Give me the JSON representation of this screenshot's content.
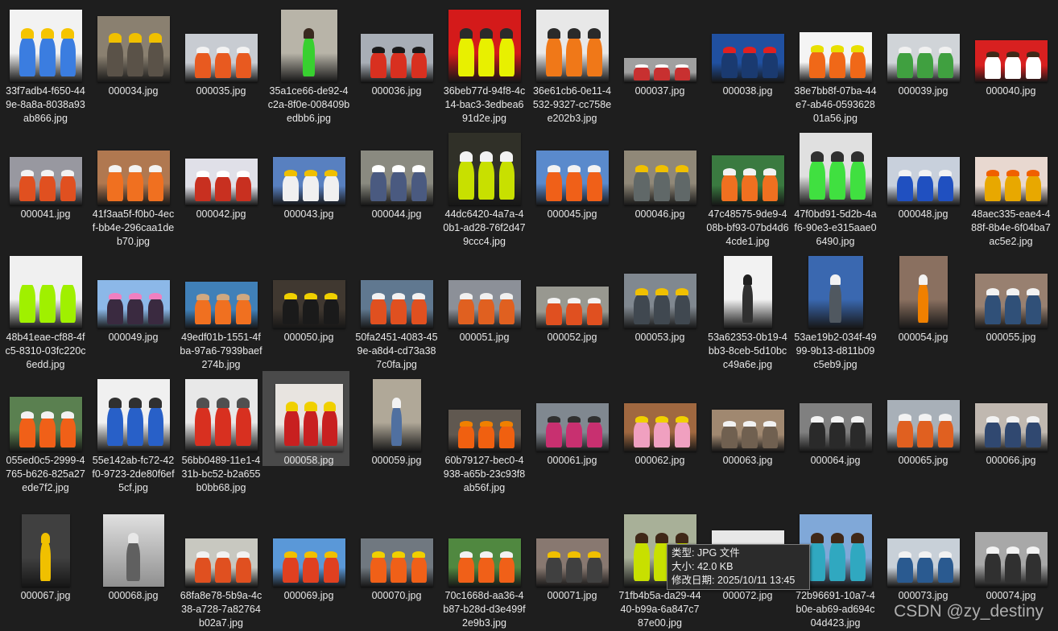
{
  "items": [
    {
      "name": "33f7adb4-f650-449e-8a8a-8038a93ab866.jpg",
      "w": 90,
      "h": 90,
      "bg": "#f2f2f2",
      "acc": "#3b7de0",
      "hat": "#f5c400"
    },
    {
      "name": "000034.jpg",
      "w": 90,
      "h": 82,
      "bg": "#8a8070",
      "acc": "#5a5248",
      "hat": "#f0c000"
    },
    {
      "name": "000035.jpg",
      "w": 90,
      "h": 60,
      "bg": "#c8ccd2",
      "acc": "#e85a20",
      "hat": "#f2f2f2"
    },
    {
      "name": "35a1ce66-de92-4c2a-8f0e-008409bedbb6.jpg",
      "w": 70,
      "h": 90,
      "bg": "#b8b4a8",
      "acc": "#38d030",
      "hat": "#3a2a20"
    },
    {
      "name": "000036.jpg",
      "w": 90,
      "h": 60,
      "bg": "#a8aeb6",
      "acc": "#d83020",
      "hat": "#1a1a1a"
    },
    {
      "name": "36beb77d-94f8-4c14-bac3-3edbea691d2e.jpg",
      "w": 90,
      "h": 90,
      "bg": "#d41a1a",
      "acc": "#e8f000",
      "hat": "#2a2a2a"
    },
    {
      "name": "36e61cb6-0e11-4532-9327-cc758ee202b3.jpg",
      "w": 90,
      "h": 90,
      "bg": "#e8e8e8",
      "acc": "#f07818",
      "hat": "#2a2a2a"
    },
    {
      "name": "000037.jpg",
      "w": 90,
      "h": 30,
      "bg": "#a0a0a0",
      "acc": "#c83030",
      "hat": "#ffffff"
    },
    {
      "name": "000038.jpg",
      "w": 90,
      "h": 60,
      "bg": "#2050a0",
      "acc": "#1a3a70",
      "hat": "#e02020"
    },
    {
      "name": "38e7bb8f-07ba-44e7-ab46-059362801a56.jpg",
      "w": 90,
      "h": 62,
      "bg": "#f4f4f4",
      "acc": "#f06818",
      "hat": "#e8e000"
    },
    {
      "name": "000039.jpg",
      "w": 90,
      "h": 60,
      "bg": "#d0d4d8",
      "acc": "#40a040",
      "hat": "#f0f0f0"
    },
    {
      "name": "000040.jpg",
      "w": 90,
      "h": 52,
      "bg": "#d82020",
      "acc": "#ffffff",
      "hat": "#402818"
    },
    {
      "name": "000041.jpg",
      "w": 90,
      "h": 60,
      "bg": "#9898a0",
      "acc": "#e05020",
      "hat": "#f2f2f2"
    },
    {
      "name": "41f3aa5f-f0b0-4ecf-bb4e-296caa1deb70.jpg",
      "w": 90,
      "h": 68,
      "bg": "#b07850",
      "acc": "#f07020",
      "hat": "#f2f2f2"
    },
    {
      "name": "000042.jpg",
      "w": 90,
      "h": 58,
      "bg": "#e0e0e8",
      "acc": "#c83020",
      "hat": "#ffffff"
    },
    {
      "name": "000043.jpg",
      "w": 90,
      "h": 60,
      "bg": "#5880c0",
      "acc": "#f0f0f0",
      "hat": "#f0c000"
    },
    {
      "name": "000044.jpg",
      "w": 90,
      "h": 68,
      "bg": "#8a8a80",
      "acc": "#4a5a80",
      "hat": "#ffffff"
    },
    {
      "name": "44dc6420-4a7a-40b1-ad28-76f2d479ccc4.jpg",
      "w": 90,
      "h": 90,
      "bg": "#303028",
      "acc": "#c8e000",
      "hat": "#f2f2f2"
    },
    {
      "name": "000045.jpg",
      "w": 90,
      "h": 68,
      "bg": "#5a8acc",
      "acc": "#f06018",
      "hat": "#f2f2f2"
    },
    {
      "name": "000046.jpg",
      "w": 90,
      "h": 68,
      "bg": "#908878",
      "acc": "#606868",
      "hat": "#f0c000"
    },
    {
      "name": "47c48575-9de9-408b-bf93-07bd4d64cde1.jpg",
      "w": 90,
      "h": 62,
      "bg": "#3a7a40",
      "acc": "#f07020",
      "hat": "#f2f2f2"
    },
    {
      "name": "47f0bd91-5d2b-4af6-90e3-e315aae06490.jpg",
      "w": 90,
      "h": 90,
      "bg": "#e0e0e0",
      "acc": "#40e040",
      "hat": "#303030"
    },
    {
      "name": "000048.jpg",
      "w": 90,
      "h": 60,
      "bg": "#c8d0dc",
      "acc": "#2050c0",
      "hat": "#f2f2f2"
    },
    {
      "name": "48aec335-eae4-488f-8b4e-6f04ba7ac5e2.jpg",
      "w": 90,
      "h": 60,
      "bg": "#e8d8d0",
      "acc": "#e8a800",
      "hat": "#f06000"
    },
    {
      "name": "48b41eae-cf88-4fc5-8310-03fc220c6edd.jpg",
      "w": 90,
      "h": 90,
      "bg": "#f0f0f0",
      "acc": "#a0f000",
      "hat": "#f0f0f0"
    },
    {
      "name": "000049.jpg",
      "w": 90,
      "h": 60,
      "bg": "#8cb8e8",
      "acc": "#3a2a40",
      "hat": "#f080c0"
    },
    {
      "name": "49edf01b-1551-4fba-97a6-7939baef274b.jpg",
      "w": 90,
      "h": 58,
      "bg": "#4080b8",
      "acc": "#f07020",
      "hat": "#d0a880"
    },
    {
      "name": "000050.jpg",
      "w": 90,
      "h": 60,
      "bg": "#403830",
      "acc": "#1a1a1a",
      "hat": "#f0d000"
    },
    {
      "name": "50fa2451-4083-459e-a8d4-cd73a387c0fa.jpg",
      "w": 90,
      "h": 60,
      "bg": "#607890",
      "acc": "#e05020",
      "hat": "#f2f2f2"
    },
    {
      "name": "000051.jpg",
      "w": 90,
      "h": 60,
      "bg": "#8c9098",
      "acc": "#e06020",
      "hat": "#f0f0f0"
    },
    {
      "name": "000052.jpg",
      "w": 90,
      "h": 52,
      "bg": "#989890",
      "acc": "#e05020",
      "hat": "#f2f2f2"
    },
    {
      "name": "000053.jpg",
      "w": 90,
      "h": 68,
      "bg": "#808890",
      "acc": "#404850",
      "hat": "#f0c000"
    },
    {
      "name": "53a62353-0b19-4bb3-8ceb-5d10bcc49a6e.jpg",
      "w": 60,
      "h": 90,
      "bg": "#f2f2f2",
      "acc": "#303030",
      "hat": "#202020"
    },
    {
      "name": "53ae19b2-034f-4999-9b13-d811b09c5eb9.jpg",
      "w": 68,
      "h": 90,
      "bg": "#3a68b0",
      "acc": "#505860",
      "hat": "#f2f2f2"
    },
    {
      "name": "000054.jpg",
      "w": 60,
      "h": 90,
      "bg": "#8a7060",
      "acc": "#f08000",
      "hat": "#f2f2f2"
    },
    {
      "name": "000055.jpg",
      "w": 90,
      "h": 68,
      "bg": "#988070",
      "acc": "#305078",
      "hat": "#f2f2f2"
    },
    {
      "name": "055ed0c5-2999-4765-b626-825a27ede7f2.jpg",
      "w": 90,
      "h": 68,
      "bg": "#5a8050",
      "acc": "#f06018",
      "hat": "#f2f2f2"
    },
    {
      "name": "55e142ab-fc72-42f0-9723-2de80f6ef5cf.jpg",
      "w": 90,
      "h": 90,
      "bg": "#f0f0f0",
      "acc": "#2860c8",
      "hat": "#303030"
    },
    {
      "name": "56bb0489-11e1-431b-bc52-b2a655b0bb68.jpg",
      "w": 90,
      "h": 90,
      "bg": "#e8e8e8",
      "acc": "#d83020",
      "hat": "#505050"
    },
    {
      "name": "000058.jpg",
      "w": 84,
      "h": 84,
      "bg": "#e8e4e0",
      "acc": "#c82020",
      "hat": "#f0d000",
      "selected": true
    },
    {
      "name": "000059.jpg",
      "w": 60,
      "h": 90,
      "bg": "#b0a898",
      "acc": "#5070a0",
      "hat": "#f2f2f2"
    },
    {
      "name": "60b79127-bec0-4938-a65b-23c93f8ab56f.jpg",
      "w": 90,
      "h": 52,
      "bg": "#605850",
      "acc": "#f06010",
      "hat": "#f08000"
    },
    {
      "name": "000061.jpg",
      "w": 90,
      "h": 60,
      "bg": "#808890",
      "acc": "#c83070",
      "hat": "#303030"
    },
    {
      "name": "000062.jpg",
      "w": 90,
      "h": 60,
      "bg": "#a06840",
      "acc": "#f0a0c0",
      "hat": "#f0d000"
    },
    {
      "name": "000063.jpg",
      "w": 90,
      "h": 52,
      "bg": "#a08870",
      "acc": "#706050",
      "hat": "#f2f2f2"
    },
    {
      "name": "000064.jpg",
      "w": 90,
      "h": 60,
      "bg": "#808080",
      "acc": "#2a2a2a",
      "hat": "#f2f2f2"
    },
    {
      "name": "000065.jpg",
      "w": 90,
      "h": 64,
      "bg": "#a8b0b8",
      "acc": "#e06020",
      "hat": "#f2f2f2"
    },
    {
      "name": "000066.jpg",
      "w": 90,
      "h": 60,
      "bg": "#c0b8b0",
      "acc": "#304870",
      "hat": "#f2f2f2"
    },
    {
      "name": "000067.jpg",
      "w": 60,
      "h": 90,
      "bg": "#404040",
      "acc": "#f0c000",
      "hat": "#f0c000"
    },
    {
      "name": "000068.jpg",
      "w": 76,
      "h": 90,
      "bg": "#d0d0d0",
      "acc": "#606060",
      "hat": "#e8e8e8",
      "gray": true
    },
    {
      "name": "68fa8e78-5b9a-4c38-a728-7a82764b02a7.jpg",
      "w": 90,
      "h": 60,
      "bg": "#c8c8c0",
      "acc": "#e05020",
      "hat": "#f2f2f2"
    },
    {
      "name": "000069.jpg",
      "w": 90,
      "h": 60,
      "bg": "#5a98d8",
      "acc": "#e04020",
      "hat": "#f0c000"
    },
    {
      "name": "000070.jpg",
      "w": 90,
      "h": 60,
      "bg": "#707880",
      "acc": "#f06018",
      "hat": "#f0d000"
    },
    {
      "name": "70c1668d-aa36-4b87-b28d-d3e499f2e9b3.jpg",
      "w": 90,
      "h": 60,
      "bg": "#508840",
      "acc": "#f06018",
      "hat": "#f2f2f2"
    },
    {
      "name": "000071.jpg",
      "w": 90,
      "h": 60,
      "bg": "#887870",
      "acc": "#404040",
      "hat": "#f0c000"
    },
    {
      "name": "71fb4b5a-da29-4440-b99a-6a847c787e00.jpg",
      "w": 90,
      "h": 90,
      "bg": "#a8b098",
      "acc": "#c8e000",
      "hat": "#402818"
    },
    {
      "name": "000072.jpg",
      "w": 90,
      "h": 70,
      "bg": "#e8e8e8",
      "acc": "#d0d0d0",
      "hat": "#a0a0a0"
    },
    {
      "name": "72b96691-10a7-4b0e-ab69-ad694c04d423.jpg",
      "w": 90,
      "h": 90,
      "bg": "#80a8d8",
      "acc": "#30a8c0",
      "hat": "#402818"
    },
    {
      "name": "000073.jpg",
      "w": 90,
      "h": 60,
      "bg": "#c8d0d8",
      "acc": "#2a5a90",
      "hat": "#f2f2f2"
    },
    {
      "name": "000074.jpg",
      "w": 90,
      "h": 68,
      "bg": "#a8a8a8",
      "acc": "#303030",
      "hat": "#f2f2f2"
    }
  ],
  "tooltip": {
    "type": "类型: JPG 文件",
    "size": "大小: 42.0 KB",
    "modified": "修改日期: 2025/10/11 13:45"
  },
  "watermark": "CSDN @zy_destiny"
}
